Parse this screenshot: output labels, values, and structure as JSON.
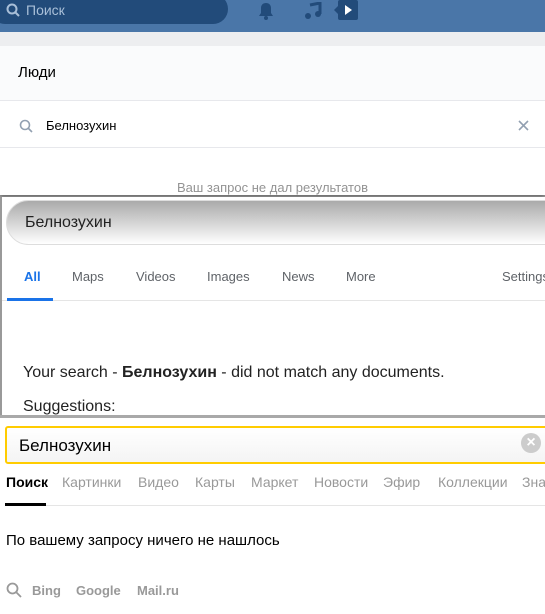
{
  "vk": {
    "search_placeholder": "Поиск",
    "section": "Люди",
    "query": "Белнозухин",
    "empty": "Ваш запрос не дал результатов",
    "colors": {
      "header": "#4a76a8"
    }
  },
  "google": {
    "query": "Белнозухин",
    "tabs": [
      "All",
      "Maps",
      "Videos",
      "Images",
      "News",
      "More"
    ],
    "settings": "Settings",
    "msg_pre": "Your search - ",
    "msg_query": "Белнозухин",
    "msg_post": " - did not match any documents.",
    "suggestions": "Suggestions:",
    "colors": {
      "active": "#1a73e8"
    }
  },
  "yandex": {
    "query": "Белнозухин",
    "tabs": [
      "Поиск",
      "Картинки",
      "Видео",
      "Карты",
      "Маркет",
      "Новости",
      "Эфир",
      "Коллекции",
      "Зна"
    ],
    "empty": "По вашему запросу ничего не нашлось",
    "alt_engines": [
      "Bing",
      "Google",
      "Mail.ru"
    ],
    "colors": {
      "border": "#ffcc00"
    }
  }
}
